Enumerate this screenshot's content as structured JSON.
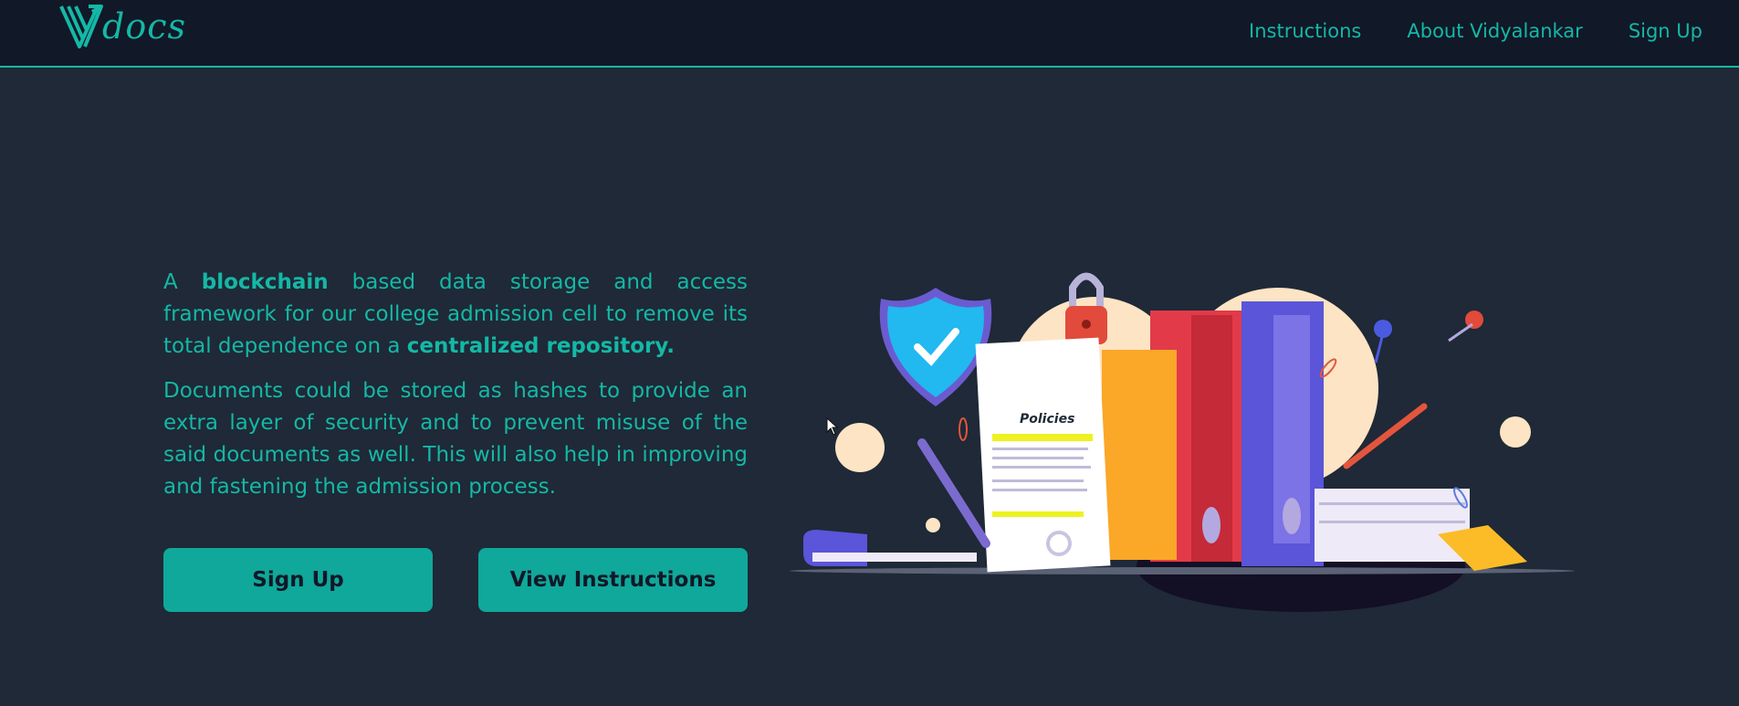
{
  "nav": {
    "logo_text": "docs",
    "links": [
      "Instructions",
      "About Vidyalankar",
      "Sign Up"
    ]
  },
  "hero": {
    "p1_a": "A ",
    "p1_b": "blockchain",
    "p1_c": " based data storage and access framework for our college admission cell to remove its total dependence on a ",
    "p1_d": "centralized repository.",
    "p2": "Documents could be stored as hashes to provide an extra layer of security and to prevent misuse of the said documents as well. This will also help in improving and fastening the admission process."
  },
  "buttons": {
    "signup": "Sign Up",
    "instructions": "View Instructions"
  },
  "illustration": {
    "label": "Policies"
  },
  "colors": {
    "accent": "#14b8a6",
    "background": "#1f2937",
    "navbar": "#111827",
    "button": "#0fa89b"
  }
}
